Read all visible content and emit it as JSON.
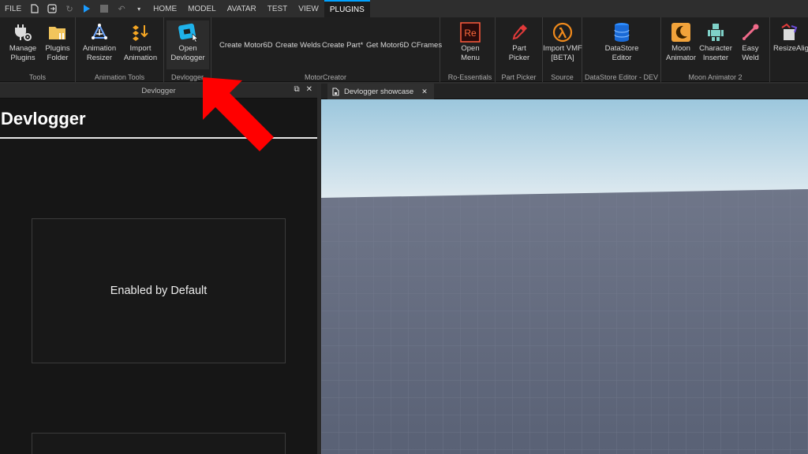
{
  "menubar": {
    "file": "FILE",
    "tabs": [
      "HOME",
      "MODEL",
      "AVATAR",
      "TEST",
      "VIEW",
      "PLUGINS"
    ],
    "active_tab": "PLUGINS"
  },
  "ribbon": {
    "tools": {
      "label": "Tools",
      "manage_plugins": "Manage\nPlugins",
      "plugins_folder": "Plugins\nFolder"
    },
    "animation_tools": {
      "label": "Animation Tools",
      "animation_resizer": "Animation\nResizer",
      "import_animation": "Import\nAnimation"
    },
    "devlogger": {
      "label": "Devlogger",
      "open_devlogger": "Open\nDevlogger"
    },
    "motorcreator": {
      "label": "MotorCreator",
      "create_motor6d": "Create Motor6D",
      "create_welds": "Create Welds",
      "create_part": "Create Part*",
      "get_motor6d_cframes": "Get Motor6D CFrames"
    },
    "ro_essentials": {
      "label": "Ro-Essentials",
      "open_menu": "Open\nMenu",
      "icon_text": "Re"
    },
    "part_picker": {
      "label": "Part Picker",
      "part_picker_btn": "Part\nPicker"
    },
    "source": {
      "label": "Source",
      "import_vmf": "Import VMF\n[BETA]"
    },
    "datastore": {
      "label": "DataStore Editor - DEV",
      "datastore_editor": "DataStore\nEditor"
    },
    "moon_animator": {
      "label": "Moon Animator 2",
      "moon_animator_btn": "Moon\nAnimator",
      "character_inserter": "Character\nInserter",
      "easy_weld": "Easy\nWeld"
    },
    "resize_align": {
      "resize_align_btn": "ResizeAlign"
    }
  },
  "panel": {
    "title": "Devlogger",
    "header": "Devlogger",
    "card_text": "Enabled by Default"
  },
  "document": {
    "tab_label": "Devlogger showcase"
  },
  "colors": {
    "accent": "#00a2ff",
    "annotation_arrow": "#ff0000",
    "sky_top": "#9cc7dd",
    "baseplate": "#5c6477"
  }
}
